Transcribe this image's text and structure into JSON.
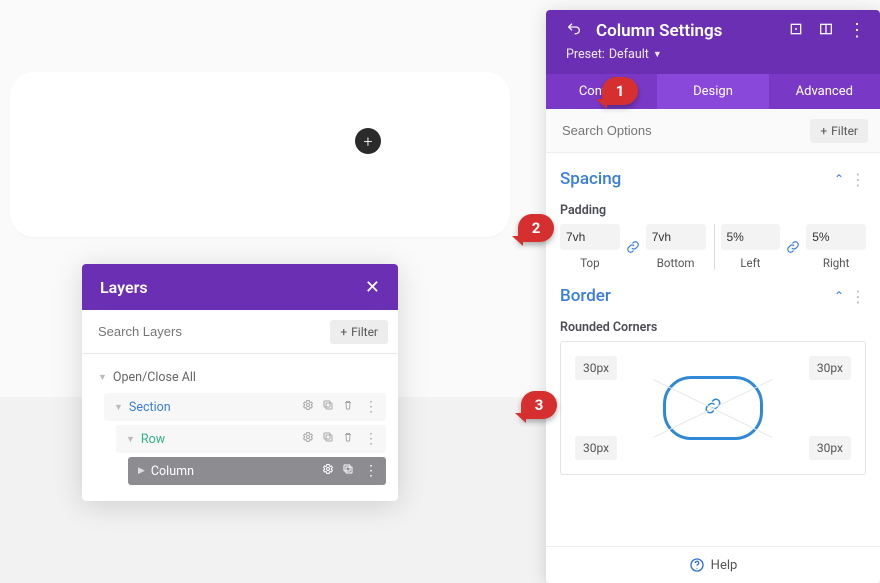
{
  "canvas": {
    "plus_glyph": "+"
  },
  "layers": {
    "title": "Layers",
    "search_placeholder": "Search Layers",
    "filter_label": "Filter",
    "open_close_label": "Open/Close All",
    "items": [
      {
        "label": "Section"
      },
      {
        "label": "Row"
      },
      {
        "label": "Column"
      }
    ]
  },
  "settings": {
    "title": "Column Settings",
    "preset_label": "Preset:",
    "preset_value": "Default",
    "tabs": [
      {
        "label": "Content"
      },
      {
        "label": "Design"
      },
      {
        "label": "Advanced"
      }
    ],
    "active_tab_index": 1,
    "search_placeholder": "Search Options",
    "filter_label": "Filter",
    "spacing": {
      "section_title": "Spacing",
      "padding_label": "Padding",
      "top": {
        "value": "7vh",
        "side": "Top"
      },
      "bottom": {
        "value": "7vh",
        "side": "Bottom"
      },
      "left": {
        "value": "5%",
        "side": "Left"
      },
      "right": {
        "value": "5%",
        "side": "Right"
      }
    },
    "border": {
      "section_title": "Border",
      "rounded_label": "Rounded Corners",
      "tl": "30px",
      "tr": "30px",
      "bl": "30px",
      "br": "30px"
    },
    "help_label": "Help"
  },
  "callouts": {
    "1": "1",
    "2": "2",
    "3": "3"
  },
  "colors": {
    "brand_purple": "#6b2fb3",
    "tab_purple": "#8a48db",
    "link_blue": "#3a7fd6",
    "row_green": "#33b18a",
    "callout_red": "#d62f2f"
  }
}
